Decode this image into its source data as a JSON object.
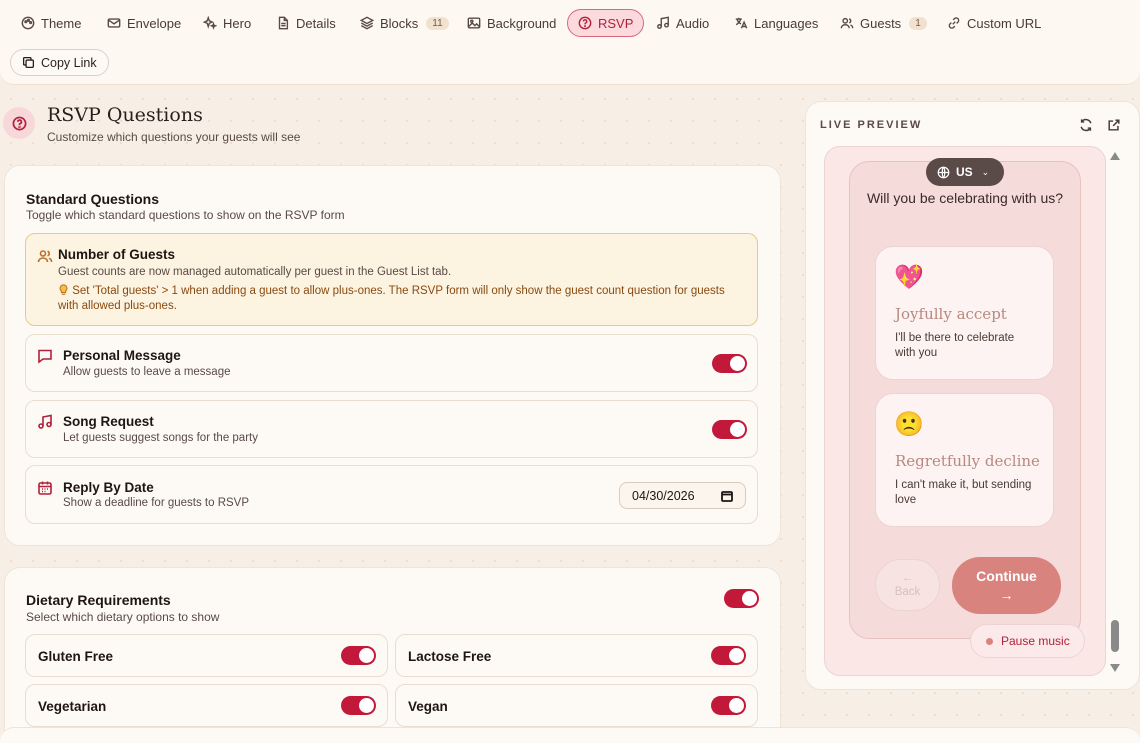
{
  "tabs": [
    {
      "label": "Theme",
      "icon": "palette-icon"
    },
    {
      "label": "Envelope",
      "icon": "envelope-icon"
    },
    {
      "label": "Hero",
      "icon": "sparkles-icon"
    },
    {
      "label": "Details",
      "icon": "document-icon"
    },
    {
      "label": "Blocks",
      "icon": "layers-icon",
      "badge": "11"
    },
    {
      "label": "Background",
      "icon": "image-icon"
    },
    {
      "label": "RSVP",
      "icon": "help-circle-icon",
      "active": true
    },
    {
      "label": "Audio",
      "icon": "music-note-icon"
    },
    {
      "label": "Languages",
      "icon": "translate-icon"
    },
    {
      "label": "Guests",
      "icon": "users-icon",
      "badge": "1"
    },
    {
      "label": "Custom URL",
      "icon": "link-icon"
    }
  ],
  "copy_link_label": "Copy Link",
  "section": {
    "title": "RSVP Questions",
    "subtitle": "Customize which questions your guests will see"
  },
  "standard": {
    "title": "Standard Questions",
    "subtitle": "Toggle which standard questions to show on the RSVP form",
    "guests": {
      "title": "Number of Guests",
      "subtitle": "Guest counts are now managed automatically per guest in the Guest List tab.",
      "tip": "Set 'Total guests' > 1 when adding a guest to allow plus-ones. The RSVP form will only show the guest count question for guests with allowed plus-ones."
    },
    "message": {
      "title": "Personal Message",
      "subtitle": "Allow guests to leave a message",
      "enabled": true
    },
    "song": {
      "title": "Song Request",
      "subtitle": "Let guests suggest songs for the party",
      "enabled": true
    },
    "reply": {
      "title": "Reply By Date",
      "subtitle": "Show a deadline for guests to RSVP",
      "date": "04/30/2026"
    }
  },
  "dietary": {
    "title": "Dietary Requirements",
    "subtitle": "Select which dietary options to show",
    "enabled": true,
    "options": [
      {
        "label": "Gluten Free",
        "enabled": true
      },
      {
        "label": "Lactose Free",
        "enabled": true
      },
      {
        "label": "Vegetarian",
        "enabled": true
      },
      {
        "label": "Vegan",
        "enabled": true
      }
    ]
  },
  "preview": {
    "label": "LIVE PREVIEW",
    "language": "US",
    "question": "Will you be celebrating with us?",
    "accept": {
      "emoji": "💖",
      "title": "Joyfully accept",
      "subtitle": "I'll be there to celebrate with you"
    },
    "decline": {
      "emoji": "🙁",
      "title": "Regretfully decline",
      "subtitle": "I can't make it, but sending love"
    },
    "back_arrow": "←",
    "back_label": "Back",
    "continue_label": "Continue",
    "continue_arrow": "→",
    "music_label": "Pause music"
  },
  "colors": {
    "accent": "#c2183a",
    "background": "#f7efe6",
    "card": "#fdfaf5",
    "tip_bg": "#fdf3e1"
  }
}
